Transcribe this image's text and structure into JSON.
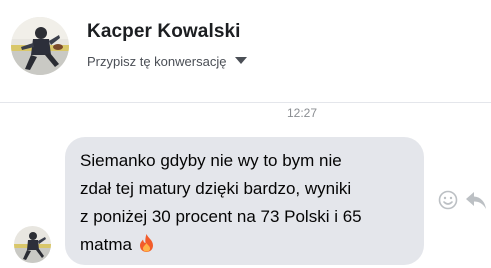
{
  "header": {
    "contact_name": "Kacper Kowalski",
    "assign_label": "Przypisz tę konwersację",
    "caret_icon": "caret-down-icon",
    "avatar_icon": "avatar"
  },
  "conversation": {
    "timestamp": "12:27",
    "messages": [
      {
        "text": "Siemanko gdyby nie wy to bym nie\nzdał tej matury dzięki bardzo, wyniki\nz poniżej 30 procent na 73 Polski i 65\nmatma ",
        "emoji": "fire-icon",
        "bubble_color": "#e4e6eb"
      }
    ],
    "actions": [
      "smiley-react-icon",
      "reply-arrow-icon"
    ]
  },
  "colors": {
    "name_text": "#1c1e21",
    "subtitle_text": "#4b4f56",
    "timestamp_text": "#8a8d91",
    "bubble_bg": "#e4e6eb",
    "flame": "#f25c2a"
  }
}
